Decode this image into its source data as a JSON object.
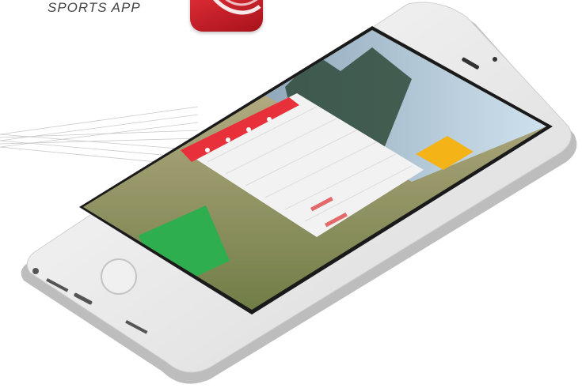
{
  "header": {
    "caption": "SPORTS APP",
    "app_icon": "sports-app-logo-icon"
  },
  "screen": {
    "primary_button_label": "",
    "menu_bar_icons": [
      "home-icon",
      "map-icon",
      "chat-icon",
      "person-icon"
    ],
    "accent_color": "#e8303a",
    "button_color": "#2fae4f",
    "highlight_color": "#f4b417"
  },
  "device": {
    "type": "smartphone"
  }
}
